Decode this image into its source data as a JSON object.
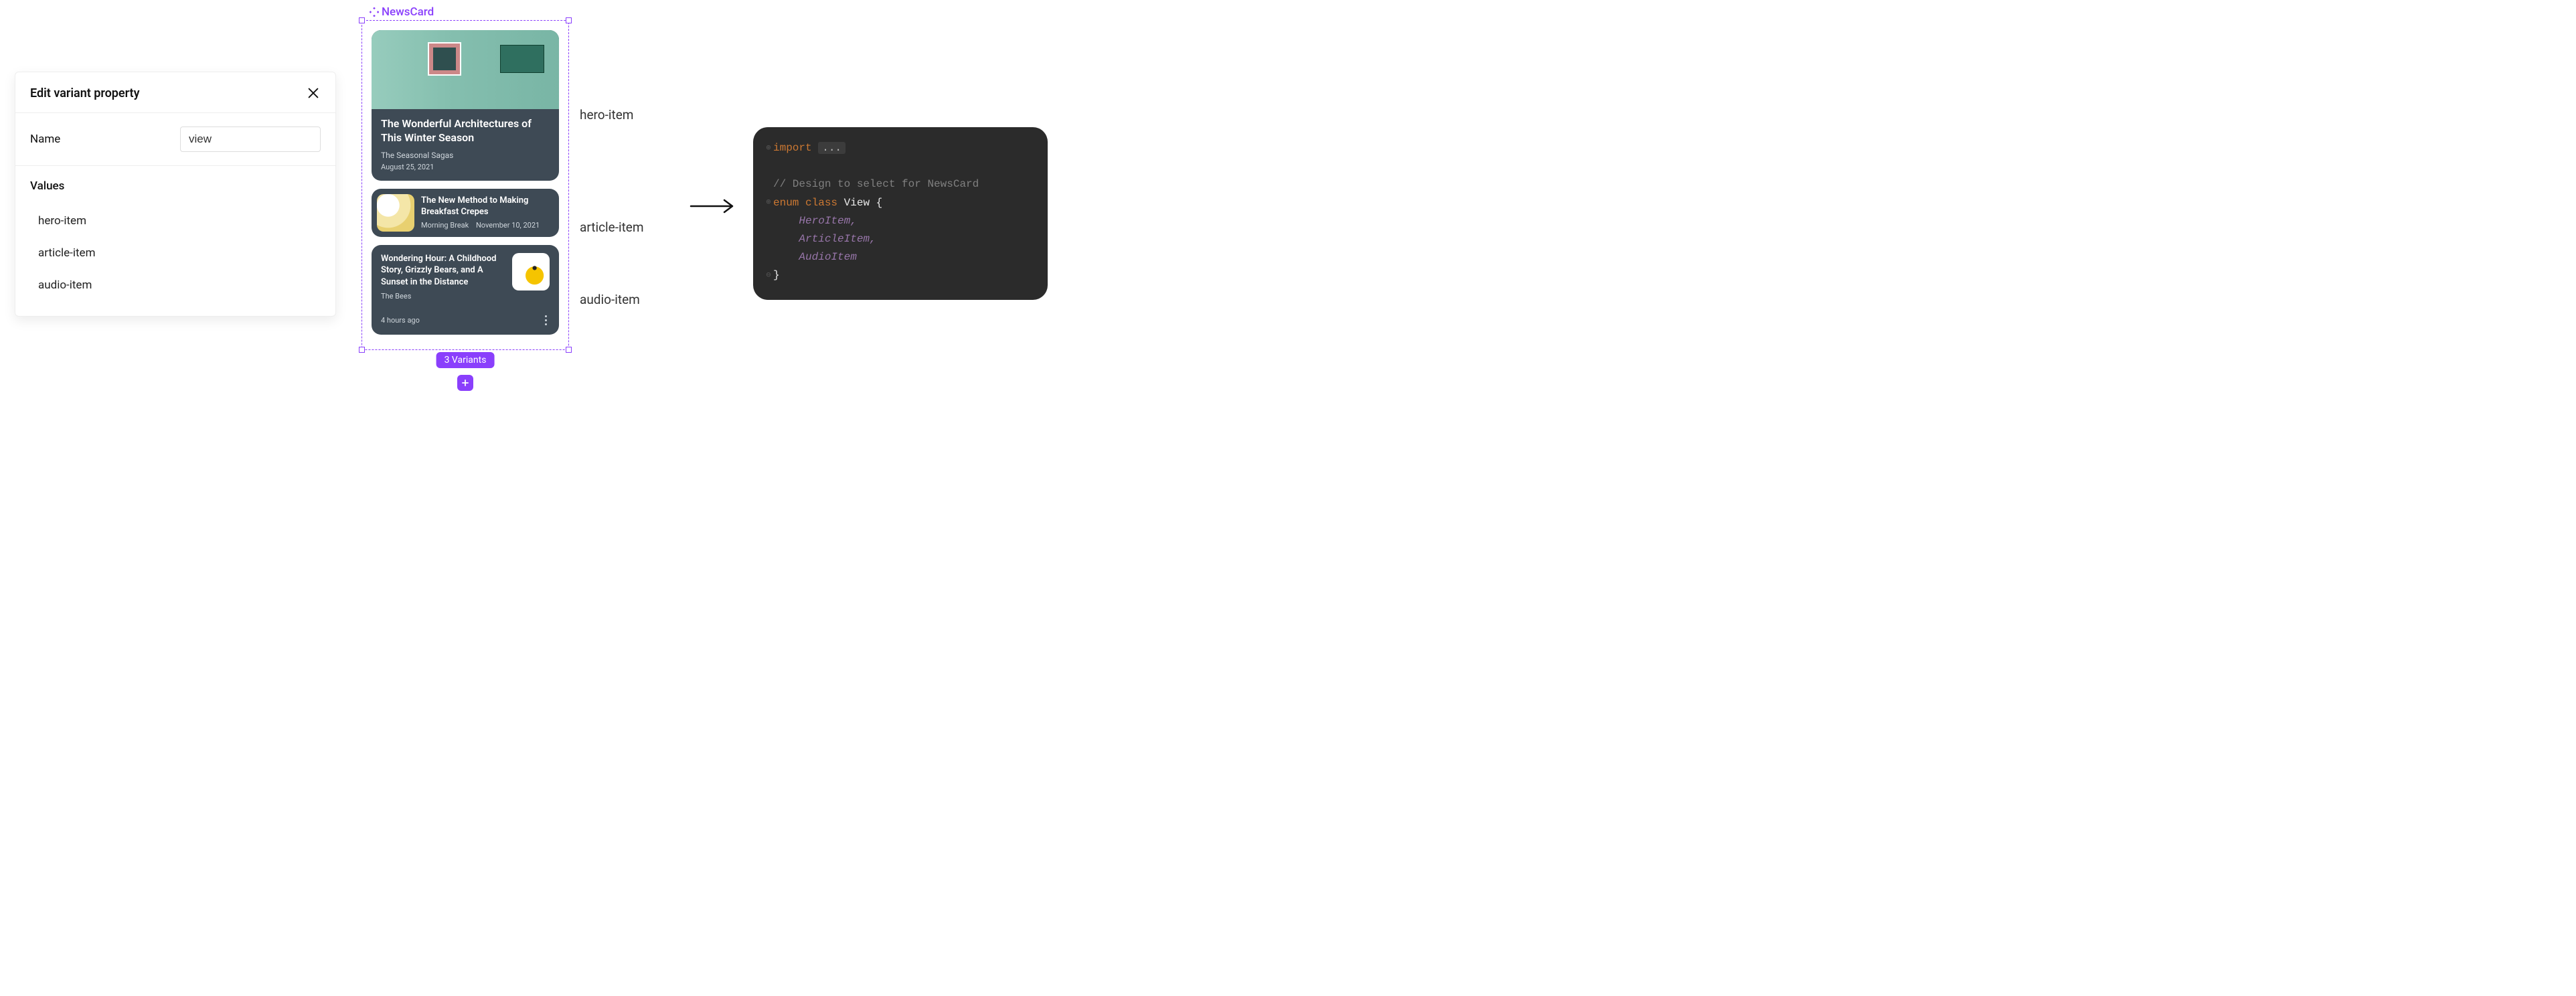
{
  "panel": {
    "title": "Edit variant property",
    "name_label": "Name",
    "name_value": "view",
    "values_label": "Values",
    "values": [
      "hero-item",
      "article-item",
      "audio-item"
    ]
  },
  "frame": {
    "label": "NewsCard",
    "variants_badge": "3 Variants"
  },
  "hero": {
    "title": "The Wonderful Architectures of This Winter Season",
    "subtitle": "The Seasonal Sagas",
    "date": "August 25, 2021"
  },
  "article": {
    "title": "The New Method to Making Breakfast Crepes",
    "source": "Morning Break",
    "date": "November 10, 2021"
  },
  "audio": {
    "title": "Wondering Hour: A Childhood Story, Grizzly Bears, and A Sunset in the Distance",
    "subtitle": "The Bees",
    "time": "4 hours ago"
  },
  "annotations": {
    "hero": "hero-item",
    "article": "article-item",
    "audio": "audio-item"
  },
  "code": {
    "import_kw": "import",
    "import_rest": " ",
    "dots": "...",
    "comment": "// Design to select for NewsCard",
    "enum_kw": "enum",
    "class_kw": "class",
    "enum_name": "View",
    "open_brace": " {",
    "v1": "HeroItem",
    "v2": "ArticleItem",
    "v3": "AudioItem",
    "comma": ",",
    "close_brace": "}"
  }
}
